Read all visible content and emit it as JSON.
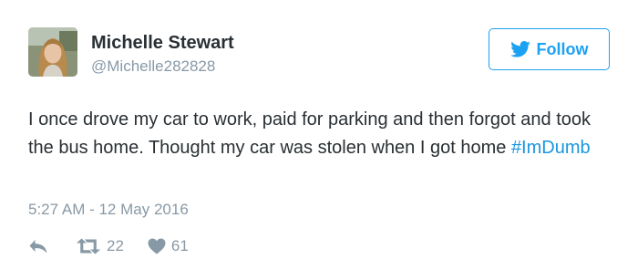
{
  "user": {
    "name": "Michelle Stewart",
    "handle": "@Michelle282828"
  },
  "follow_button": {
    "label": "Follow",
    "icon": "twitter-bird-icon"
  },
  "tweet": {
    "text": "I once drove my car to work, paid for parking and then forgot and took the bus home. Thought my car was stolen when I got home",
    "hashtag": "#ImDumb",
    "timestamp": "5:27 AM - 12 May 2016"
  },
  "actions": {
    "reply_icon": "reply-icon",
    "retweet_icon": "retweet-icon",
    "retweet_count": "22",
    "like_icon": "heart-icon",
    "like_count": "61"
  },
  "colors": {
    "accent": "#1da1f2",
    "hashtag": "#1b95e0",
    "text": "#292f33",
    "muted": "#8899a6"
  }
}
